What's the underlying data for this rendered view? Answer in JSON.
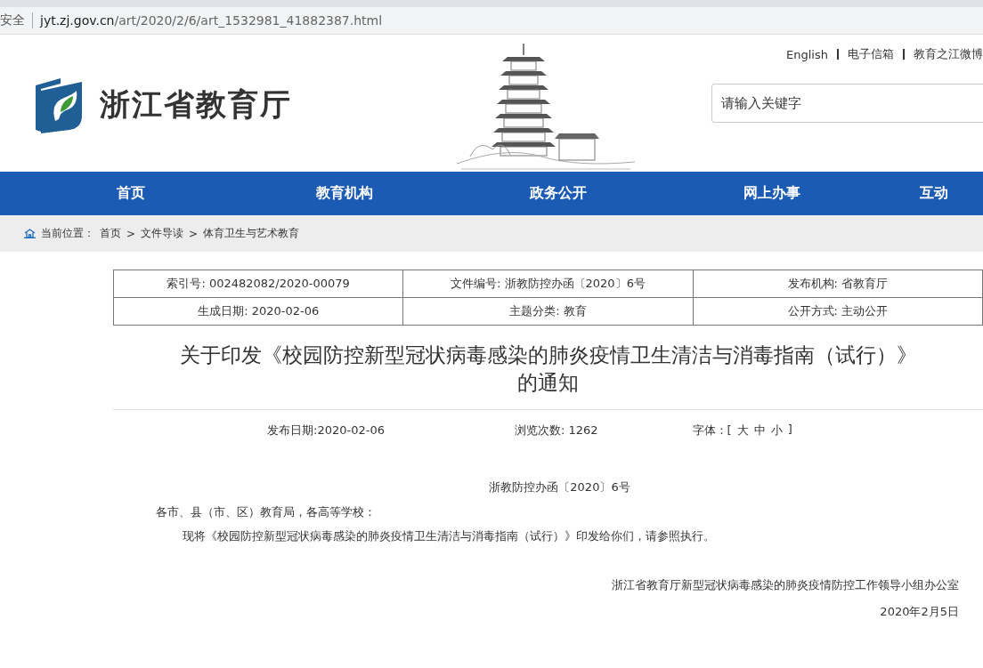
{
  "browser": {
    "security": "安全",
    "url_host": "jyt.zj.gov.cn",
    "url_path": "/art/2020/2/6/art_1532981_41882387.html"
  },
  "header": {
    "site_name": "浙江省教育厅",
    "top_links": [
      "English",
      "电子信箱",
      "教育之江微博"
    ],
    "search": {
      "placeholder": "请输入关键字"
    }
  },
  "nav": {
    "items": [
      "首页",
      "教育机构",
      "政务公开",
      "网上办事",
      "互动"
    ]
  },
  "breadcrumb": {
    "label": "当前位置：",
    "separator": ">",
    "items": [
      "首页",
      "文件导读",
      "体育卫生与艺术教育"
    ]
  },
  "meta_table": {
    "rows": [
      [
        "索引号: 002482082/2020-00079",
        "文件编号: 浙教防控办函〔2020〕6号",
        "发布机构: 省教育厅"
      ],
      [
        "生成日期: 2020-02-06",
        "主题分类: 教育",
        "公开方式: 主动公开"
      ]
    ]
  },
  "article": {
    "title_lines": [
      "关于印发《校园防控新型冠状病毒感染的肺炎疫情卫生清洁与消毒指南（试行）》",
      "的通知"
    ],
    "info": {
      "date": "发布日期:2020-02-06",
      "views": "浏览次数: 1262",
      "font_label": "字体：[",
      "font_sizes": [
        "大",
        "中",
        "小"
      ],
      "font_close": "]"
    },
    "doc_number": "浙教防控办函〔2020〕6号",
    "salutation": "各市、县（市、区）教育局，各高等学校：",
    "body": "现将《校园防控新型冠状病毒感染的肺炎疫情卫生清洁与消毒指南（试行）》印发给你们，请参照执行。",
    "signature": "浙江省教育厅新型冠状病毒感染的肺炎疫情防控工作领导小组办公室",
    "date": "2020年2月5日"
  }
}
